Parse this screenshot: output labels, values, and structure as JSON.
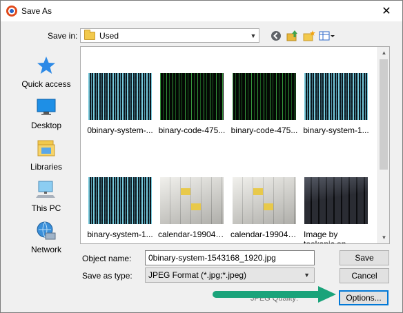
{
  "window": {
    "title": "Save As",
    "close_glyph": "✕"
  },
  "savein": {
    "label": "Save in:",
    "value": "Used"
  },
  "places": [
    {
      "label": "Quick access",
      "icon": "star-icon"
    },
    {
      "label": "Desktop",
      "icon": "desktop-icon"
    },
    {
      "label": "Libraries",
      "icon": "libraries-icon"
    },
    {
      "label": "This PC",
      "icon": "computer-icon"
    },
    {
      "label": "Network",
      "icon": "network-icon"
    }
  ],
  "files": [
    {
      "name": "0binary-system-...",
      "thumb": "binary-blue"
    },
    {
      "name": "binary-code-475...",
      "thumb": "binary-green"
    },
    {
      "name": "binary-code-475...",
      "thumb": "binary-green"
    },
    {
      "name": "binary-system-1...",
      "thumb": "binary-blue"
    },
    {
      "name": "binary-system-1...",
      "thumb": "binary-blue"
    },
    {
      "name": "calendar-199045...",
      "thumb": "calendar"
    },
    {
      "name": "calendar-199045...",
      "thumb": "calendar"
    },
    {
      "name": "Image by tookapic on Pixabay_keyb...",
      "thumb": "keyboard"
    }
  ],
  "form": {
    "object_name_label": "Object name:",
    "object_name_value": "0binary-system-1543168_1920.jpg",
    "type_label": "Save as type:",
    "type_value": "JPEG Format (*.jpg;*.jpeg)",
    "hidden_label": "JPEG Quality:"
  },
  "buttons": {
    "save": "Save",
    "cancel": "Cancel",
    "options": "Options..."
  },
  "colors": {
    "accent": "#0078d7",
    "annotation_arrow": "#1aa37a"
  }
}
